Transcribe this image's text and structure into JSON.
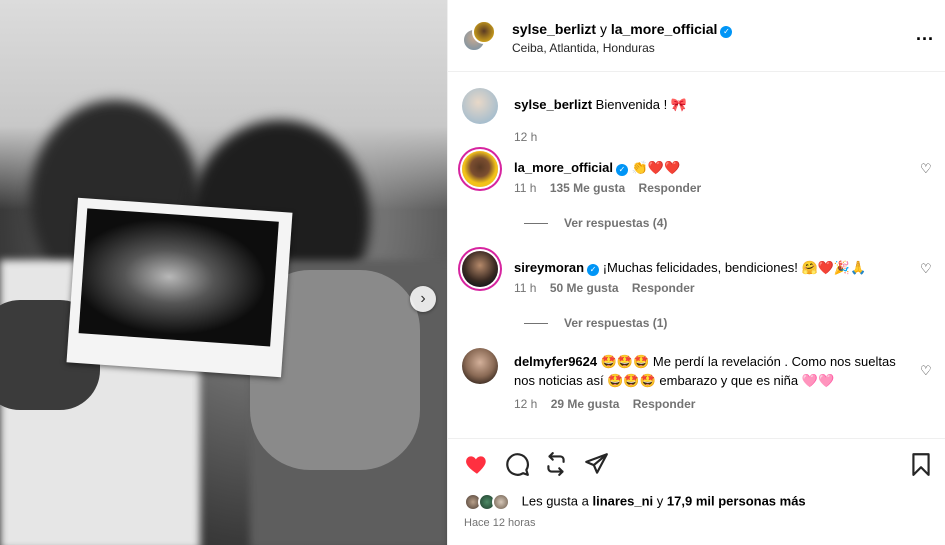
{
  "post": {
    "nav_next_icon": "chevron-right-icon"
  },
  "header": {
    "user1": "sylse_berlizt",
    "joiner": "y",
    "user2": "la_more_official",
    "location": "Ceiba, Atlantida, Honduras",
    "more_icon": "more-horizontal-icon",
    "more_label": "..."
  },
  "comments": [
    {
      "username": "sylse_berlizt",
      "text": "Bienvenida ! 🎀",
      "time": "12 h",
      "verified": false
    },
    {
      "username": "la_more_official",
      "text": "👏❤️❤️",
      "time": "11 h",
      "likes": "135 Me gusta",
      "reply": "Responder",
      "view_replies": "Ver respuestas (4)",
      "verified": true
    },
    {
      "username": "sireymoran",
      "text": "¡Muchas felicidades, bendiciones! 🤗❤️🎉🙏",
      "time": "11 h",
      "likes": "50 Me gusta",
      "reply": "Responder",
      "view_replies": "Ver respuestas (1)",
      "verified": true
    },
    {
      "username": "delmyfer9624",
      "text": "🤩🤩🤩 Me perdí la revelación . Como nos sueltas nos noticias así 🤩🤩🤩 embarazo y que es niña 🩷🩷",
      "time": "12 h",
      "likes": "29 Me gusta",
      "reply": "Responder",
      "verified": false
    }
  ],
  "actions": {
    "like_icon": "heart-filled-icon",
    "comment_icon": "comment-icon",
    "share_icon": "repost-icon",
    "send_icon": "send-icon",
    "save_icon": "bookmark-icon",
    "likes_prefix": "Les gusta a",
    "likes_user": "linares_ni",
    "likes_joiner": "y",
    "likes_count": "17,9 mil personas más",
    "timestamp": "Hace 12 horas"
  },
  "colors": {
    "accent": "#0095f6",
    "like_red": "#ff3040",
    "muted": "#737373"
  }
}
